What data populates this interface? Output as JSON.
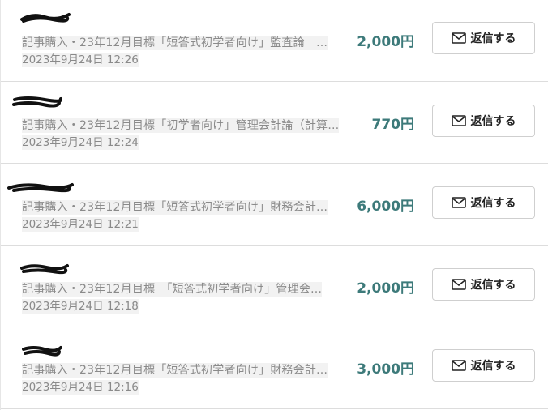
{
  "messages": [
    {
      "title": "記事購入・23年12月目標「短答式初学者向け」監査論　…",
      "date": "2023年9月24日 12:26",
      "price": "2,000円",
      "reply_label": "返信する"
    },
    {
      "title": "記事購入・23年12月目標「初学者向け」管理会計論（計算…",
      "date": "2023年9月24日 12:24",
      "price": "770円",
      "reply_label": "返信する"
    },
    {
      "title": "記事購入・23年12月目標「短答式初学者向け」財務会計…",
      "date": "2023年9月24日 12:21",
      "price": "6,000円",
      "reply_label": "返信する"
    },
    {
      "title": "記事購入・23年12月目標　「短答式初学者向け」管理会…",
      "date": "2023年9月24日 12:18",
      "price": "2,000円",
      "reply_label": "返信する"
    },
    {
      "title": "記事購入・23年12月目標「短答式初学者向け」財務会計…",
      "date": "2023年9月24日 12:16",
      "price": "3,000円",
      "reply_label": "返信する"
    }
  ],
  "icons": {
    "reply": "mail-icon",
    "sender": "redacted-name"
  },
  "colors": {
    "price": "#3d7a7a",
    "meta_text": "#8a8a8a"
  }
}
